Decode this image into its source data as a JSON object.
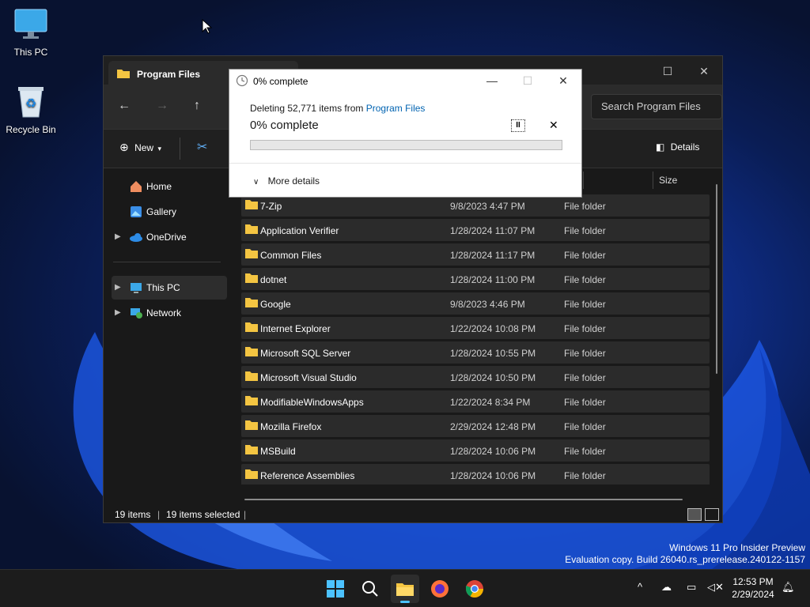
{
  "desktop": {
    "icons": [
      {
        "label": "This PC"
      },
      {
        "label": "Recycle Bin"
      }
    ],
    "watermark": {
      "line1": "Windows 11 Pro Insider Preview",
      "line2": "Evaluation copy. Build 26040.rs_prerelease.240122-1157"
    }
  },
  "explorer": {
    "tab_title": "Program Files",
    "search_placeholder": "Search Program Files",
    "toolbar": {
      "new_label": "New",
      "details_label": "Details"
    },
    "sidebar": {
      "items": [
        {
          "label": "Home"
        },
        {
          "label": "Gallery"
        },
        {
          "label": "OneDrive"
        },
        {
          "label": "This PC"
        },
        {
          "label": "Network"
        }
      ]
    },
    "columns": {
      "size": "Size"
    },
    "rows": [
      {
        "name": "7-Zip",
        "date": "9/8/2023 4:47 PM",
        "type": "File folder"
      },
      {
        "name": "Application Verifier",
        "date": "1/28/2024 11:07 PM",
        "type": "File folder"
      },
      {
        "name": "Common Files",
        "date": "1/28/2024 11:17 PM",
        "type": "File folder"
      },
      {
        "name": "dotnet",
        "date": "1/28/2024 11:00 PM",
        "type": "File folder"
      },
      {
        "name": "Google",
        "date": "9/8/2023 4:46 PM",
        "type": "File folder"
      },
      {
        "name": "Internet Explorer",
        "date": "1/22/2024 10:08 PM",
        "type": "File folder"
      },
      {
        "name": "Microsoft SQL Server",
        "date": "1/28/2024 10:55 PM",
        "type": "File folder"
      },
      {
        "name": "Microsoft Visual Studio",
        "date": "1/28/2024 10:50 PM",
        "type": "File folder"
      },
      {
        "name": "ModifiableWindowsApps",
        "date": "1/22/2024 8:34 PM",
        "type": "File folder"
      },
      {
        "name": "Mozilla Firefox",
        "date": "2/29/2024 12:48 PM",
        "type": "File folder"
      },
      {
        "name": "MSBuild",
        "date": "1/28/2024 10:06 PM",
        "type": "File folder"
      },
      {
        "name": "Reference Assemblies",
        "date": "1/28/2024 10:06 PM",
        "type": "File folder"
      }
    ],
    "status": {
      "items": "19 items",
      "selected": "19 items selected"
    }
  },
  "dialog": {
    "title": "0% complete",
    "desc_prefix": "Deleting 52,771 items from ",
    "desc_link": "Program Files",
    "percent_text": "0% complete",
    "progress": 0,
    "more_details": "More details"
  },
  "taskbar": {
    "time": "12:53 PM",
    "date": "2/29/2024"
  },
  "colors": {
    "accent": "#0063b1",
    "folder": "#f4c542"
  }
}
